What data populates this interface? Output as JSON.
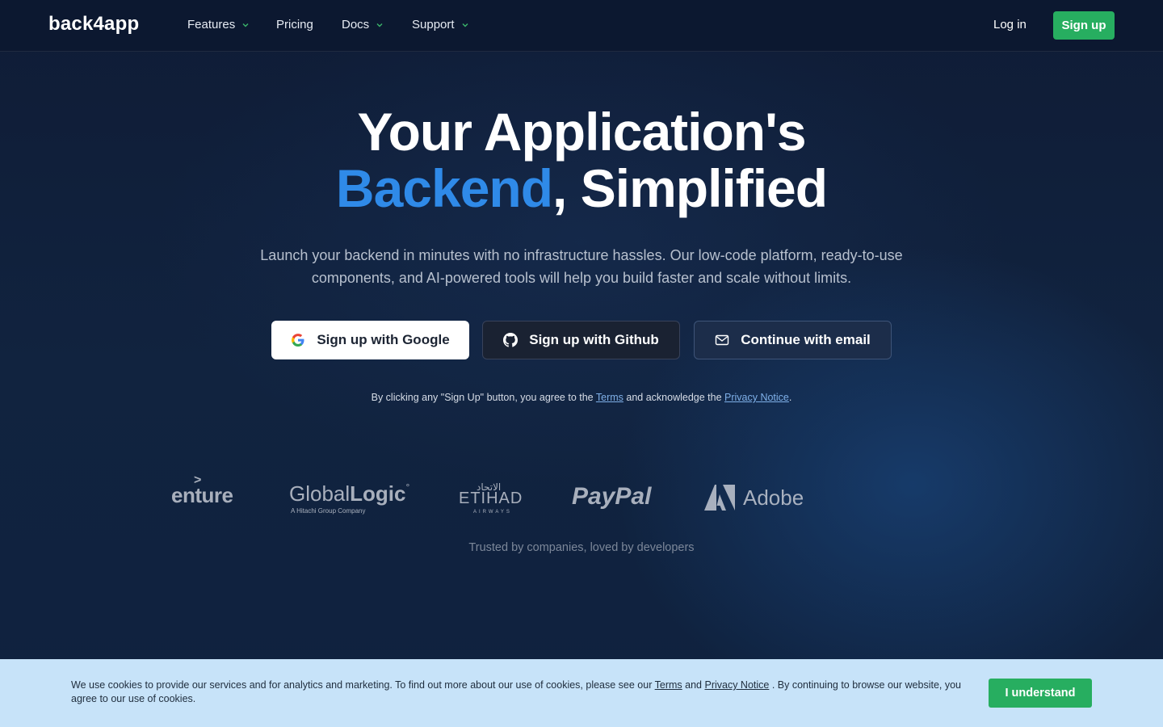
{
  "nav": {
    "logo": "back4app",
    "items": [
      {
        "label": "Features",
        "has_dropdown": true
      },
      {
        "label": "Pricing",
        "has_dropdown": false
      },
      {
        "label": "Docs",
        "has_dropdown": true
      },
      {
        "label": "Support",
        "has_dropdown": true
      }
    ],
    "login": "Log in",
    "signup": "Sign up"
  },
  "hero": {
    "title_line1": "Your Application's",
    "title_accent": "Backend",
    "title_rest": ", Simplified",
    "subtitle": "Launch your backend in minutes with no infrastructure hassles. Our low-code platform, ready-to-use components, and AI-powered tools will help you build faster and scale without limits.",
    "buttons": {
      "google": "Sign up with Google",
      "github": "Sign up with Github",
      "email": "Continue with email"
    },
    "legal": {
      "prefix": "By clicking any \"Sign Up\" button, you agree to the ",
      "terms": "Terms",
      "middle": " and acknowledge the ",
      "privacy": "Privacy Notice",
      "suffix": "."
    }
  },
  "logos": {
    "accenture": "enture",
    "accenture_mark": ">",
    "globallogic_a": "Global",
    "globallogic_b": "Logic",
    "globallogic_reg": "°",
    "globallogic_tag": "A Hitachi Group Company",
    "etihad_ar": "الاتحاد",
    "etihad": "ETIHAD",
    "etihad_sub": "AIRWAYS",
    "paypal": "PayPal",
    "adobe": "Adobe",
    "trusted": "Trusted by companies, loved by developers"
  },
  "cookie": {
    "text1": "We use cookies to provide our services and for analytics and marketing. To find out more about our use of cookies, please see our ",
    "terms": "Terms",
    "and": " and ",
    "privacy": "Privacy Notice",
    "text2": " . By continuing to browse our website, you agree to our use of cookies.",
    "button": "I understand"
  },
  "colors": {
    "accent_blue": "#2f8ae8",
    "green": "#27ae60",
    "cookie_bg": "#c7e3f9"
  }
}
